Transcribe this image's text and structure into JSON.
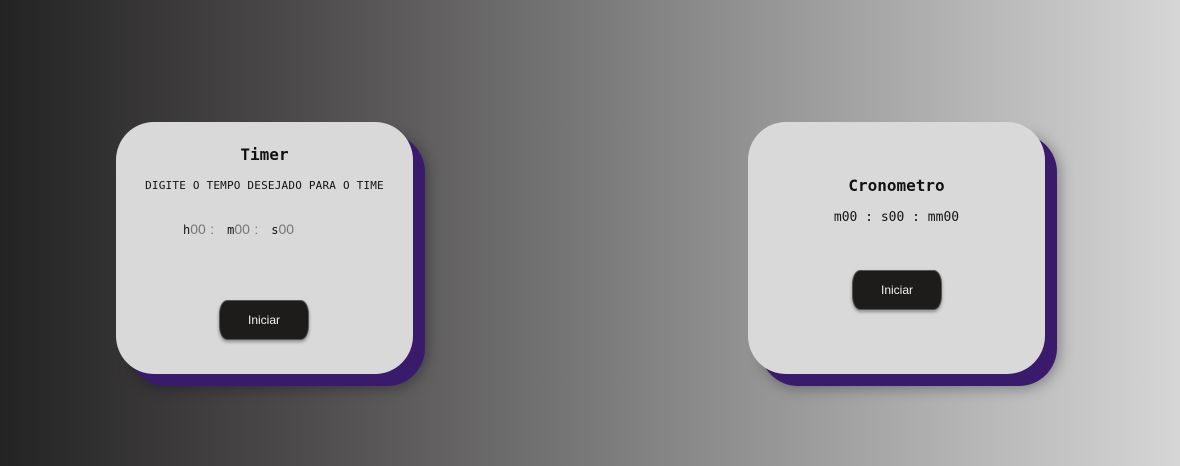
{
  "timer": {
    "title": "Timer",
    "instructions": "DIGITE O TEMPO DESEJADO PARA O TIME",
    "hours_prefix": "h",
    "hours_placeholder": "00",
    "minutes_prefix": "m",
    "minutes_placeholder": "00",
    "seconds_prefix": "s",
    "seconds_placeholder": "00",
    "separator": ":",
    "start_label": "Iniciar"
  },
  "stopwatch": {
    "title": "Cronometro",
    "display": "m00 : s00 : mm00",
    "start_label": "Iniciar"
  },
  "colors": {
    "card_background": "#d9d9d9",
    "card_shadow": "#3a1a6a",
    "button_background": "#1e1c1b"
  }
}
